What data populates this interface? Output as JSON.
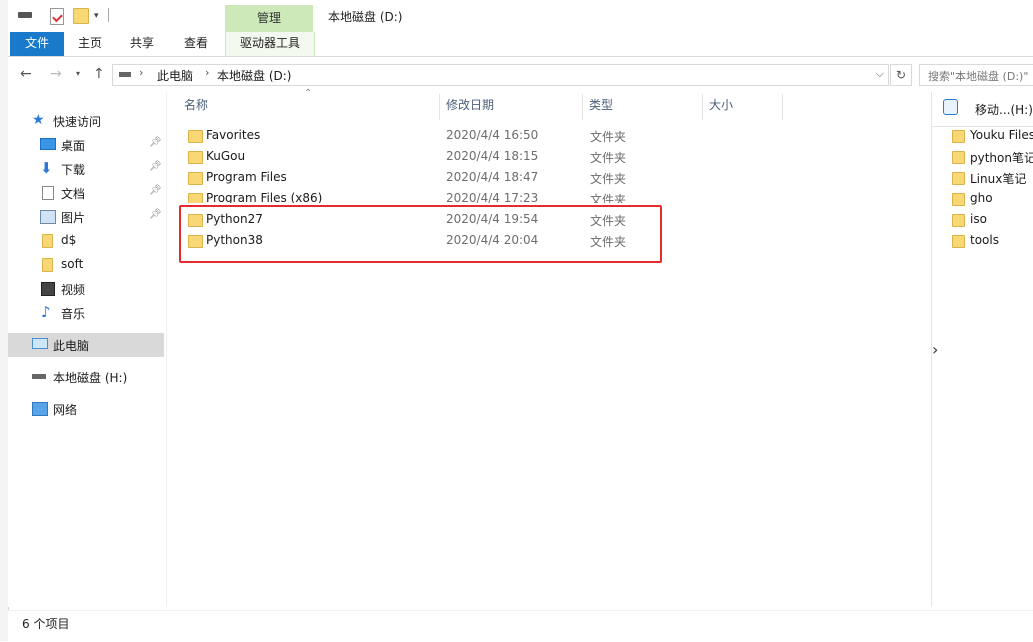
{
  "title_bar": {
    "context_tab_group": "管理",
    "window_title": "本地磁盘 (D:)"
  },
  "ribbon": {
    "tabs": [
      "文件",
      "主页",
      "共享",
      "查看",
      "驱动器工具"
    ]
  },
  "address_bar": {
    "crumbs": [
      "此电脑",
      "本地磁盘 (D:)"
    ],
    "search_placeholder": "搜索\"本地磁盘 (D:)\""
  },
  "nav_pane": {
    "quick_access": "快速访问",
    "items": [
      {
        "label": "桌面",
        "pinned": true
      },
      {
        "label": "下载",
        "pinned": true
      },
      {
        "label": "文档",
        "pinned": true
      },
      {
        "label": "图片",
        "pinned": true
      },
      {
        "label": "d$"
      },
      {
        "label": "soft"
      },
      {
        "label": "视频"
      },
      {
        "label": "音乐"
      }
    ],
    "this_pc": "此电脑",
    "drive_h": "本地磁盘 (H:)",
    "network": "网络"
  },
  "columns": {
    "name": "名称",
    "date": "修改日期",
    "type": "类型",
    "size": "大小"
  },
  "files": [
    {
      "name": "Favorites",
      "date": "2020/4/4 16:50",
      "type": "文件夹"
    },
    {
      "name": "KuGou",
      "date": "2020/4/4 18:15",
      "type": "文件夹"
    },
    {
      "name": "Program Files",
      "date": "2020/4/4 18:47",
      "type": "文件夹"
    },
    {
      "name": "Program Files (x86)",
      "date": "2020/4/4 17:23",
      "type": "文件夹"
    },
    {
      "name": "Python27",
      "date": "2020/4/4 19:54",
      "type": "文件夹"
    },
    {
      "name": "Python38",
      "date": "2020/4/4 20:04",
      "type": "文件夹"
    }
  ],
  "side_pane": {
    "title": "移动...(H:)",
    "items": [
      "Youku Files",
      "python笔记",
      "Linux笔记",
      "gho",
      "iso",
      "tools"
    ]
  },
  "status": {
    "item_count": "6 个项目"
  },
  "colors": {
    "accent": "#1979ca",
    "context_tab": "#cde9b9",
    "highlight_box": "#e52b2b"
  }
}
